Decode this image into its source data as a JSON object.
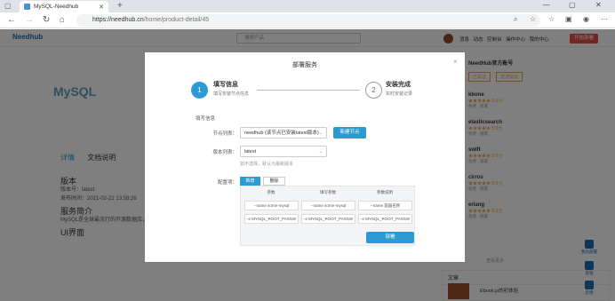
{
  "browser": {
    "tab_title": "MySQL-Needhub",
    "url_domain": "https://needhub.cn",
    "url_path": "/home/product-detail/45"
  },
  "site": {
    "logo": "Needhub",
    "search_placeholder": "搜索产品",
    "nav_links": "消息 动态 控制台 操作中心 我的中心",
    "publish_btn": "开始部署"
  },
  "product": {
    "logo_text": "MySQL",
    "tabs": [
      "详情",
      "文档说明"
    ],
    "version_heading": "版本",
    "version_line": "版本号：latest",
    "created_line": "发布时间：2021-02-22 13:58:26",
    "service_heading": "服务简介",
    "service_text": "MySQL是全球最流行的开源数据库，以...",
    "ui_heading": "UI界面"
  },
  "right_panel": {
    "title": "NeedHub官方账号",
    "btn_follow": "已关注",
    "btn_message": "发送私信",
    "items": [
      {
        "name": "kbone",
        "stars": "★★★★★ 5.0分",
        "count": "免费 · 部署"
      },
      {
        "name": "elasticsearch",
        "stars": "★★★★★ 5.0分",
        "count": "免费 · 部署"
      },
      {
        "name": "swift",
        "stars": "★★★★★ 5.0分",
        "count": "免费 · 部署"
      },
      {
        "name": "cirros",
        "stars": "★★★★★ 5.0分",
        "count": "免费 · 部署"
      },
      {
        "name": "erlang",
        "stars": "★★★★★ 5.0分",
        "count": "免费 · 部署"
      }
    ],
    "more": "查看更多",
    "article_head": "文章",
    "article_title": "Ebook.js的初体验",
    "side_buttons": [
      "我的部署",
      "客服",
      "反馈"
    ]
  },
  "modal": {
    "title": "部署服务",
    "close": "×",
    "step1_num": "1",
    "step1_title": "填写信息",
    "step1_desc": "填写安装节点信息",
    "step2_num": "2",
    "step2_title": "安装完成",
    "step2_desc": "实时安装记录",
    "section_label": "填写信息",
    "node_label": "节点列表：",
    "node_value": "needhub (该节点已安装latest版本)",
    "new_node_btn": "新建节点",
    "version_label": "版本列表：",
    "version_value": "latest",
    "version_hint": "如不选择，默认为最新版本",
    "config_label": "配置项：",
    "add_btn": "新增",
    "delete_btn": "删除",
    "table_headers": [
      "参数",
      "填写参数",
      "参数说明"
    ],
    "rows": [
      [
        "--name some-mysql",
        "--name some-mysql",
        "--name 容器名称"
      ],
      [
        "-e MYSQL_ROOT_PASSW",
        "-e MYSQL_ROOT_PASSW",
        "-e MYSQL_ROOT_PASSW"
      ]
    ],
    "deploy_btn": "部署"
  }
}
